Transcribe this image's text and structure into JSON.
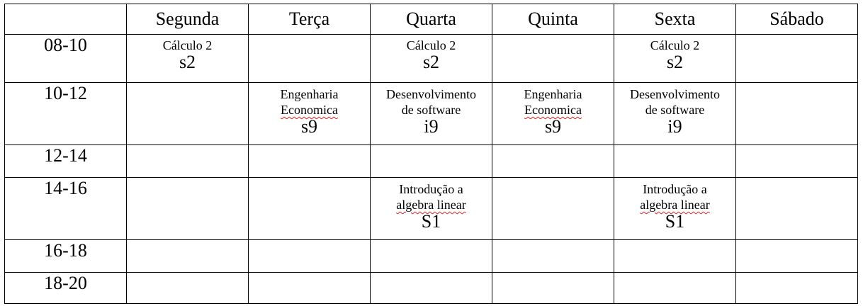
{
  "days": [
    "Segunda",
    "Terça",
    "Quarta",
    "Quinta",
    "Sexta",
    "Sábado"
  ],
  "times": [
    "08-10",
    "10-12",
    "12-14",
    "14-16",
    "16-18",
    "18-20"
  ],
  "classes": {
    "calculo": {
      "name": "Cálculo 2",
      "room": "s2"
    },
    "engenharia": {
      "line1": "Engenharia",
      "line2": "Economica",
      "room": "s9"
    },
    "desenvolvimento": {
      "line1": "Desenvolvimento",
      "line2": "de software",
      "room": "i9"
    },
    "introducao": {
      "line1": "Introdução a",
      "line2": "algebra linear",
      "room": "S1"
    }
  }
}
